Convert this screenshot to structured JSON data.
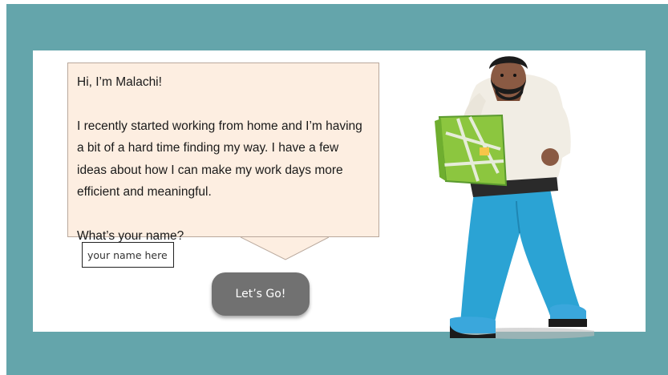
{
  "speech": {
    "greeting": "Hi, I’m Malachi!",
    "message": "I recently started working from home and I’m having a bit of a hard time finding my way. I have a few ideas about how I can make my work days more efficient and meaningful.",
    "question": "What’s your name?"
  },
  "name_field": {
    "placeholder": "your name here",
    "value": ""
  },
  "start_button": {
    "label": "Let’s Go!"
  },
  "colors": {
    "frame": "#64a5ab",
    "bubble": "#fdeee1",
    "button": "#717171",
    "pants": "#2ba3d4"
  },
  "icons": [
    "character-illustration",
    "map-icon"
  ]
}
